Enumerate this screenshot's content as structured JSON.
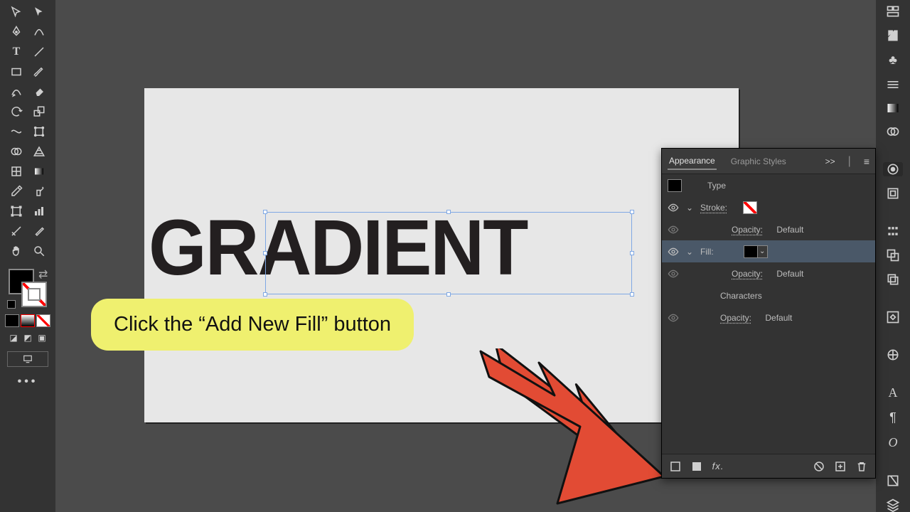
{
  "toolbar": {
    "tools": [
      [
        "selection-tool",
        "direct-selection-tool"
      ],
      [
        "pen-tool",
        "curvature-tool"
      ],
      [
        "type-tool",
        "line-tool"
      ],
      [
        "rectangle-tool",
        "brush-tool"
      ],
      [
        "shaper-tool",
        "eraser-tool"
      ],
      [
        "rotate-tool",
        "scale-tool"
      ],
      [
        "width-tool",
        "free-transform-tool"
      ],
      [
        "shape-builder-tool",
        "perspective-grid-tool"
      ],
      [
        "mesh-tool",
        "gradient-tool"
      ],
      [
        "eyedropper-tool",
        "symbol-sprayer-tool"
      ],
      [
        "column-graph-tool",
        "artboard-tool"
      ],
      [
        "slice-tool",
        "blob-brush-tool"
      ],
      [
        "hand-tool",
        "zoom-tool"
      ]
    ]
  },
  "dock_icons": [
    "properties-icon",
    "libraries-icon",
    "color-icon",
    "lines-icon",
    "gradient-icon",
    "circles-icon",
    "appearance-icon",
    "artboards-icon",
    "align-icon",
    "pathfinder-icon",
    "transform-icon",
    "brushes-icon",
    "character-icon",
    "paragraph-icon",
    "opentype-icon",
    "links-icon",
    "layers-icon"
  ],
  "artboard_text": "GRADIENT",
  "callout": {
    "text": "Click the “Add New Fill” button"
  },
  "appearance": {
    "tabs": {
      "active": "Appearance",
      "inactive": "Graphic Styles"
    },
    "collapse": ">>",
    "type_label": "Type",
    "stroke_label": "Stroke:",
    "fill_label": "Fill:",
    "opacity_label": "Opacity:",
    "opacity_value": "Default",
    "characters_label": "Characters",
    "footer": {
      "add_stroke": "add-new-stroke",
      "add_fill": "add-new-fill",
      "add_effect": "fx.",
      "clear": "clear-appearance",
      "duplicate": "duplicate-item",
      "delete": "delete-item"
    }
  }
}
